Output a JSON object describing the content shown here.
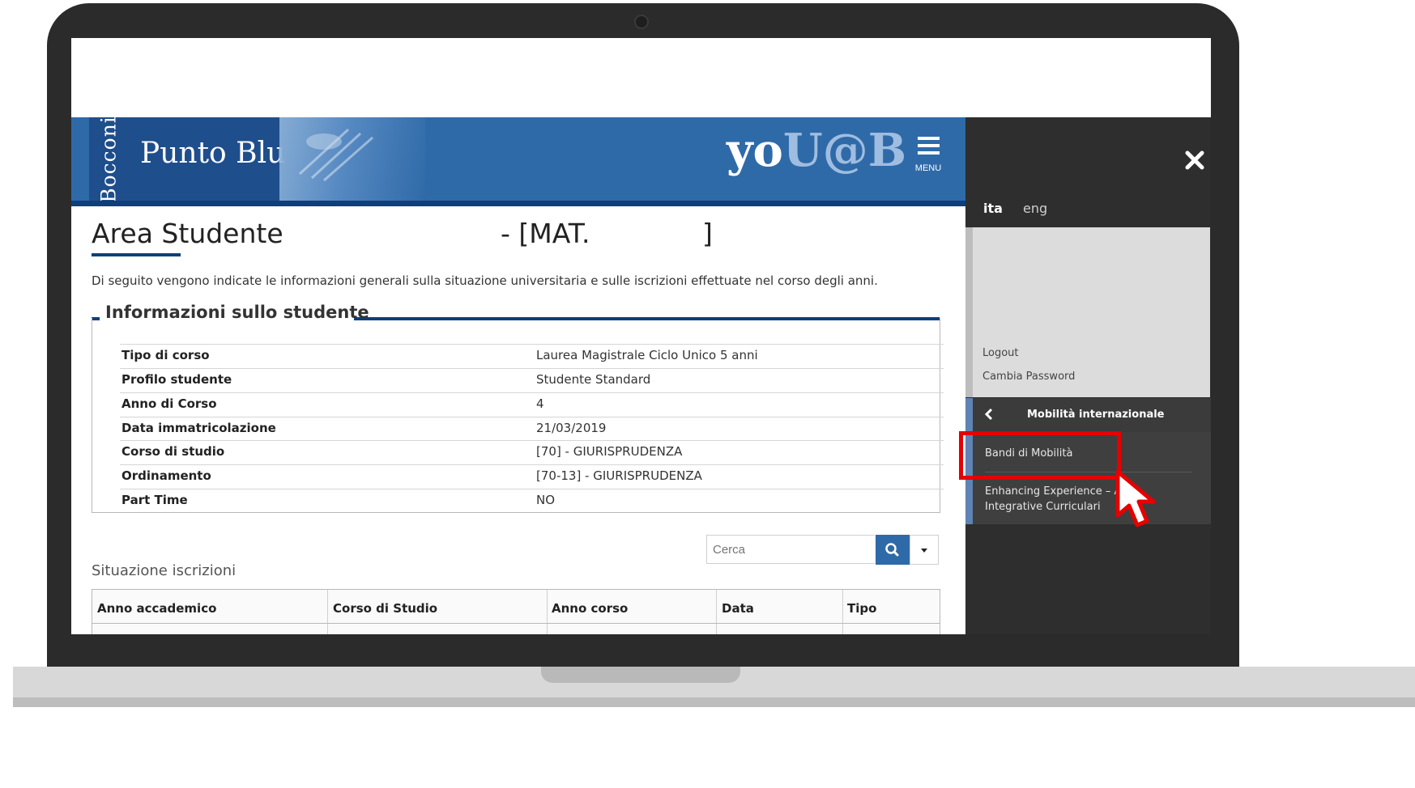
{
  "header": {
    "bocconi": "Bocconi",
    "brand": "Punto Blu",
    "logo_white": "yo",
    "logo_light": "U@B",
    "menu_label": "MENU"
  },
  "page": {
    "title": "Area Studente",
    "mat_prefix": "- [MAT.",
    "mat_suffix": "]",
    "intro": "Di seguito vengono indicate le informazioni generali sulla situazione universitaria e sulle iscrizioni effettuate nel corso degli anni."
  },
  "student_info": {
    "legend": "Informazioni sullo studente",
    "rows": [
      {
        "label": "Tipo di corso",
        "value": "Laurea Magistrale Ciclo Unico 5 anni"
      },
      {
        "label": "Profilo studente",
        "value": "Studente Standard"
      },
      {
        "label": "Anno di Corso",
        "value": "4"
      },
      {
        "label": "Data immatricolazione",
        "value": "21/03/2019"
      },
      {
        "label": "Corso di studio",
        "value": "[70] - GIURISPRUDENZA"
      },
      {
        "label": "Ordinamento",
        "value": "[70-13] - GIURISPRUDENZA"
      },
      {
        "label": "Part Time",
        "value": "NO"
      }
    ]
  },
  "search": {
    "placeholder": "Cerca",
    "icon": "search-icon",
    "dropdown_icon": "caret-down-icon"
  },
  "enrollments": {
    "title": "Situazione iscrizioni",
    "columns": [
      "Anno accademico",
      "Corso di Studio",
      "Anno corso",
      "Data",
      "Tipo"
    ]
  },
  "side_menu": {
    "lang_active": "ita",
    "lang_other": "eng",
    "logout": "Logout",
    "change_password": "Cambia Password",
    "section_title": "Mobilità internazionale",
    "items": [
      {
        "label": "Bandi di Mobilità"
      },
      {
        "label_line1": "Enhancing Experience – Att",
        "label_line2": "Integrative Curriculari"
      }
    ],
    "highlight_color": "#e60000",
    "accent_color": "#5f83b3"
  }
}
